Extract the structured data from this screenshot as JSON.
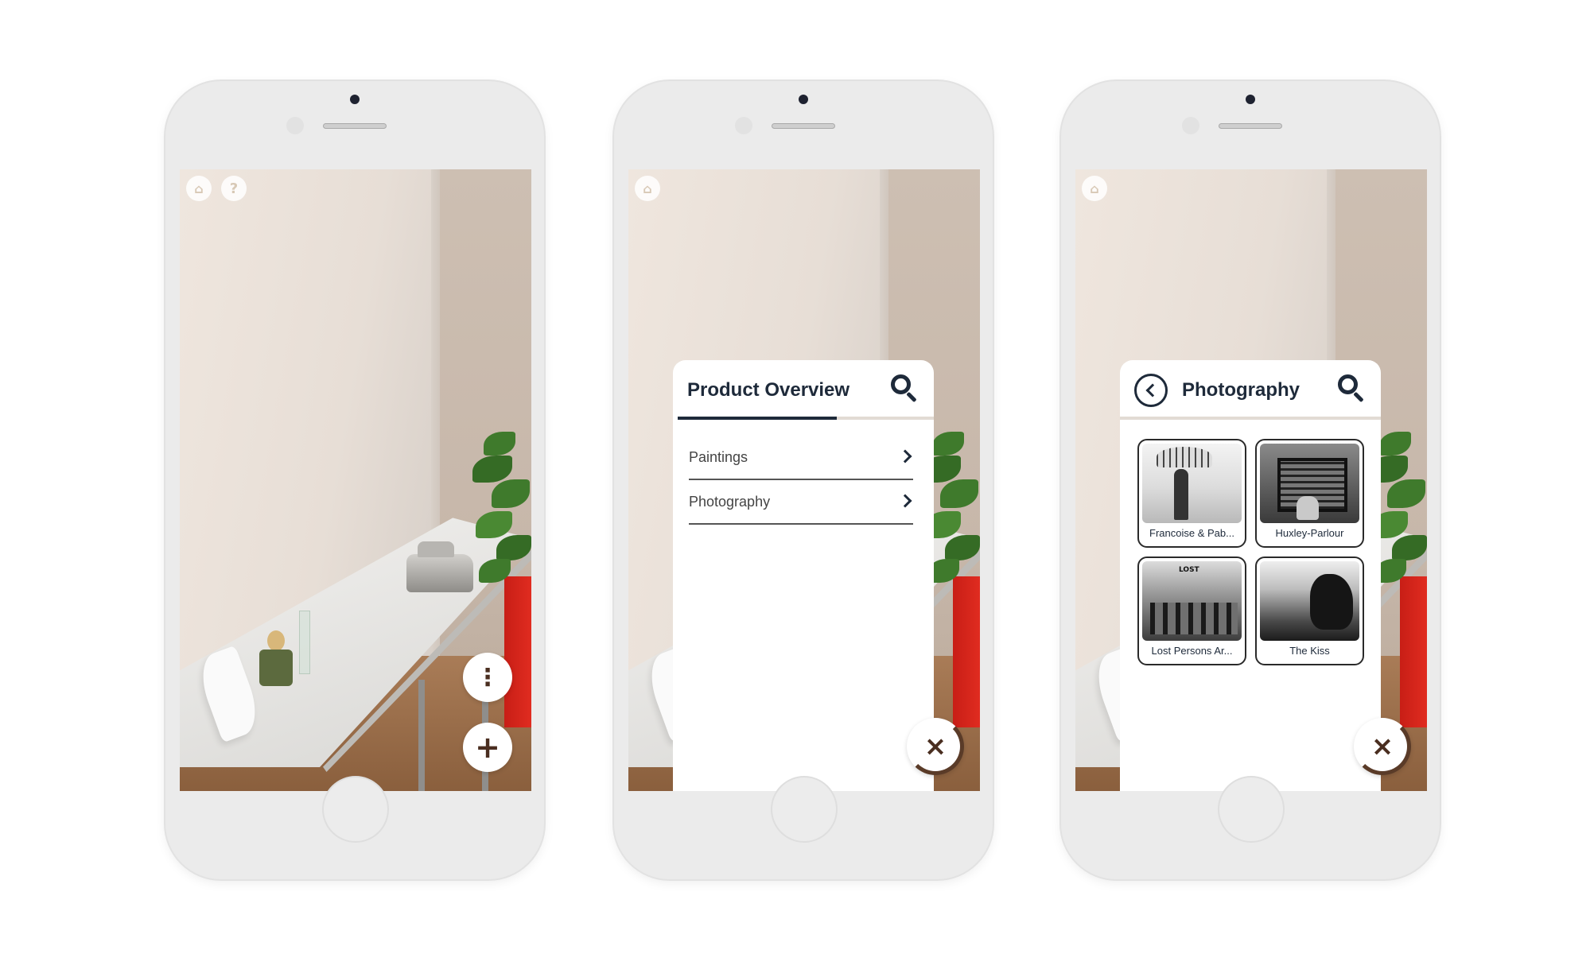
{
  "phones": [
    {
      "id": "ar-view",
      "top_icons": [
        {
          "name": "home-icon",
          "glyph": "⌂"
        },
        {
          "name": "help-icon",
          "glyph": "?"
        }
      ],
      "fabs": [
        {
          "name": "more-options-icon",
          "glyph": "⋮"
        },
        {
          "name": "add-icon",
          "glyph": "+"
        }
      ]
    },
    {
      "id": "product-overview",
      "top_icons": [
        {
          "name": "home-icon",
          "glyph": "⌂"
        }
      ],
      "panel": {
        "title": "Product Overview",
        "items": [
          {
            "label": "Paintings"
          },
          {
            "label": "Photography"
          }
        ]
      },
      "close_glyph": "×"
    },
    {
      "id": "photography",
      "top_icons": [
        {
          "name": "home-icon",
          "glyph": "⌂"
        }
      ],
      "panel": {
        "title": "Photography",
        "cards": [
          {
            "caption": "Francoise & Pab..."
          },
          {
            "caption": "Huxley-Parlour"
          },
          {
            "caption": "Lost Persons Ar..."
          },
          {
            "caption": "The Kiss"
          }
        ]
      },
      "close_glyph": "×"
    }
  ],
  "colors": {
    "accent_dark": "#1e2a3a",
    "fab_glyph": "#4a2e20",
    "fab_ring": "#5a3b28"
  }
}
